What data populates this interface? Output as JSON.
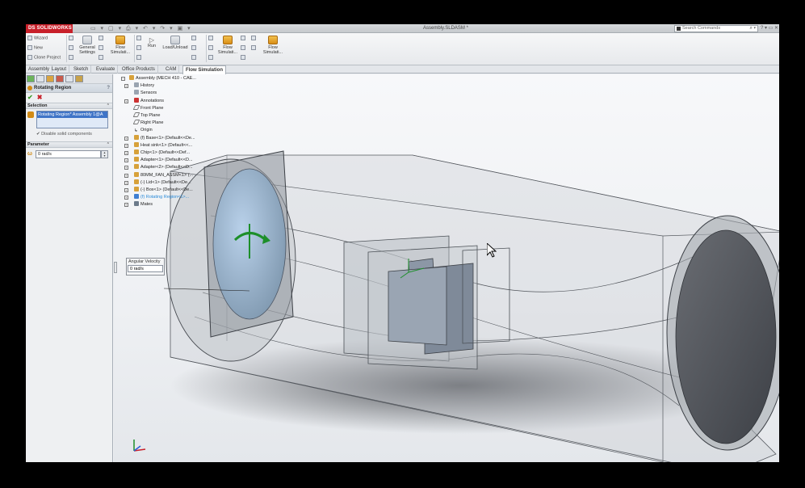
{
  "app": {
    "logo": "DS SOLIDWORKS",
    "document_title": "Assembly.SLDASM *",
    "search_placeholder": "Search Commands"
  },
  "ribbon": {
    "wizard": "Wizard",
    "new": "New",
    "clone_project": "Clone Project",
    "general_settings": "General Settings",
    "flow_simulation_1": "Flow Simulati...",
    "run": "Run",
    "load_unload": "Load/Unload",
    "flow_simulation_2": "Flow Simulati...",
    "flow_simulation_3": "Flow Simulati..."
  },
  "tabs": [
    {
      "label": "Assembly"
    },
    {
      "label": "Layout"
    },
    {
      "label": "Sketch"
    },
    {
      "label": "Evaluate"
    },
    {
      "label": "Office Products"
    },
    {
      "label": "CAM"
    },
    {
      "label": "Flow Simulation"
    }
  ],
  "property_manager": {
    "title": "Rotating Region",
    "help": "?",
    "selection": {
      "header": "Selection",
      "item": "Rotating Region* Assembly 1@A",
      "disable_solid": "Disable solid components"
    },
    "parameter": {
      "header": "Parameter",
      "value": "0 rad/s"
    }
  },
  "tree": {
    "root": "Assembly (MECH 410 - CAE...",
    "items": [
      {
        "label": "History",
        "icon": "folder-icon"
      },
      {
        "label": "Sensors",
        "icon": "sensor-icon"
      },
      {
        "label": "Annotations",
        "icon": "annotation-icon"
      },
      {
        "label": "Front Plane",
        "icon": "plane-icon"
      },
      {
        "label": "Top Plane",
        "icon": "plane-icon"
      },
      {
        "label": "Right Plane",
        "icon": "plane-icon"
      },
      {
        "label": "Origin",
        "icon": "origin-icon"
      },
      {
        "label": "(f) Base<1> (Default<<De...",
        "icon": "part-icon"
      },
      {
        "label": "Heat sink<1> (Default<<...",
        "icon": "part-icon"
      },
      {
        "label": "Chip<1> (Default<<Def...",
        "icon": "part-icon"
      },
      {
        "label": "Adapter<1> (Default<<D...",
        "icon": "part-icon"
      },
      {
        "label": "Adapter<2> (Default<<D...",
        "icon": "part-icon"
      },
      {
        "label": "80MM_FAN_ASSM<1> (...",
        "icon": "assembly-icon"
      },
      {
        "label": "(-) Lid<1> (Default<<De...",
        "icon": "part-icon"
      },
      {
        "label": "(-) Box<1> (Default<<De...",
        "icon": "part-icon"
      },
      {
        "label": "(f) Rotating Region<1>...",
        "icon": "rotating-region-icon"
      },
      {
        "label": "Mates",
        "icon": "mates-icon"
      }
    ]
  },
  "callout": {
    "label": "Angular Velocity",
    "value": "0 rad/s"
  }
}
